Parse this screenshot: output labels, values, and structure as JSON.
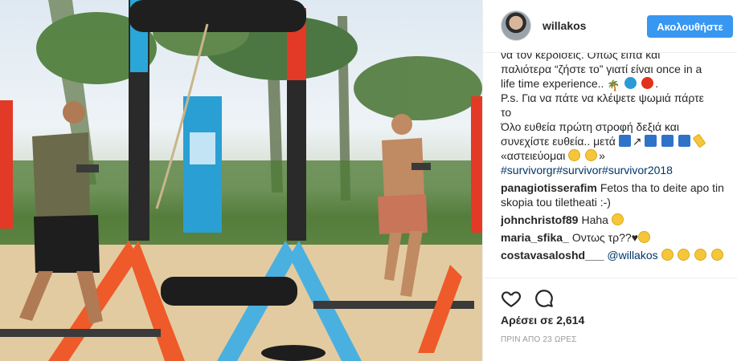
{
  "post": {
    "image_alt": "photo"
  },
  "header": {
    "username": "willakos",
    "follow_label": "Ακολουθήστε"
  },
  "caption": {
    "lines": [
      "να τον κερδίσεις. Όπως είπα και",
      "παλιότερα “ζήστε το” γιατί είναι once in a",
      "life time experience..",
      "P.s. Για να πάτε να κλέψετε ψωμιά πάρτε",
      "το",
      "Όλο ευθεία πρώτη στροφή δεξιά και",
      "συνεχίστε ευθεία.. μετά",
      "«αστειεύομαι"
    ],
    "hashtags": "#survivorgr#survivor#survivor2018"
  },
  "comments": [
    {
      "user": "panagiotisserafim",
      "text": "Fetos tha to deite apo tin skopia tou tiletheati :-)"
    },
    {
      "user": "johnchristof89",
      "text": "Haha"
    },
    {
      "user": "maria_sfika_",
      "text": "Οντως τρ??"
    },
    {
      "user": "costavasaloshd___",
      "mention": "@willakos",
      "text": ""
    }
  ],
  "icons": {
    "like": "heart-outline-icon",
    "comment": "speech-bubble-icon",
    "avatar": "profile-avatar"
  },
  "footer": {
    "likes": "Αρέσει σε 2,614",
    "timestamp": "ΠΡΙΝ ΑΠΟ 23 ΩΡΕΣ"
  },
  "colors": {
    "follow_button": "#3897f0",
    "link": "#003569",
    "text": "#262626",
    "muted": "#999999"
  }
}
